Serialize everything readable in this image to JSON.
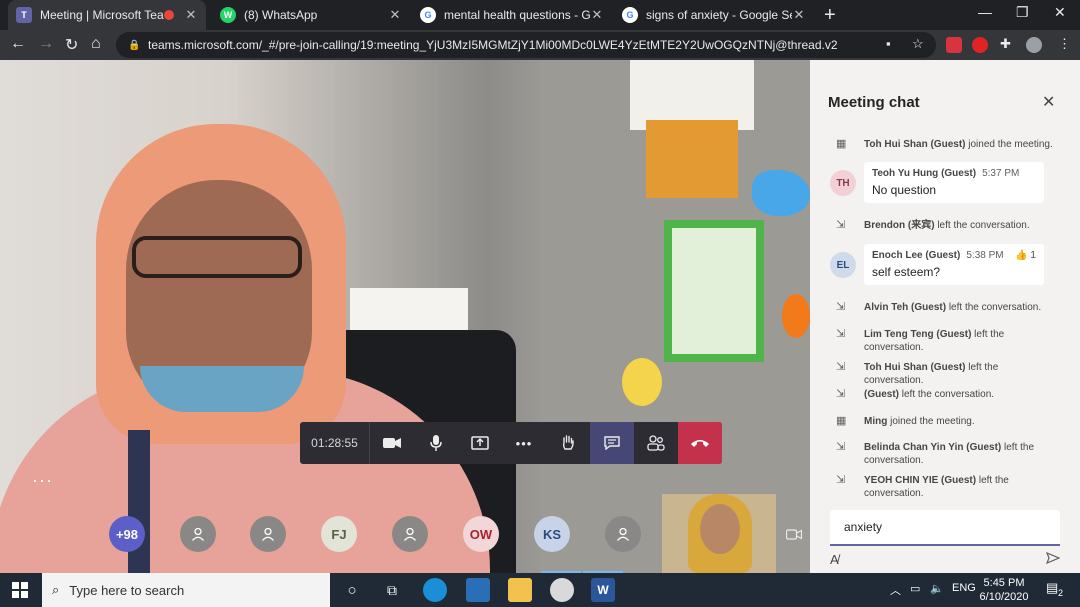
{
  "browser": {
    "tabs": [
      {
        "title": "Meeting | Microsoft Teams",
        "favicon": "T",
        "color": "#6264a7",
        "recording": true,
        "active": true
      },
      {
        "title": "(8) WhatsApp",
        "favicon": "W",
        "color": "#25d366",
        "recording": false,
        "active": false
      },
      {
        "title": "mental health questions - Googl",
        "favicon": "G",
        "color": "#4285f4",
        "recording": false,
        "active": false
      },
      {
        "title": "signs of anxiety - Google Search",
        "favicon": "G",
        "color": "#4285f4",
        "recording": false,
        "active": false
      }
    ],
    "url": "teams.microsoft.com/_#/pre-join-calling/19:meeting_YjU3MzI5MGMtZjY1Mi00MDc0LWE4YzEtMTE2Y2UwOGQzNTNj@thread.v2",
    "tab_close_glyph": "✕",
    "new_tab_glyph": "+"
  },
  "meeting": {
    "timer": "01:28:55",
    "more_glyph": "•••",
    "participants": [
      {
        "label": "+98",
        "type": "count",
        "bg": "#5b5fc7",
        "fg": "#ffffff"
      },
      {
        "label": "",
        "type": "ghost",
        "bg": "#8a8886",
        "fg": "#ffffff"
      },
      {
        "label": "",
        "type": "ghost",
        "bg": "#8a8886",
        "fg": "#ffffff"
      },
      {
        "label": "FJ",
        "type": "initials",
        "bg": "#e1e4d6",
        "fg": "#58614a"
      },
      {
        "label": "",
        "type": "ghost",
        "bg": "#8a8886",
        "fg": "#ffffff"
      },
      {
        "label": "OW",
        "type": "initials",
        "bg": "#f3d6d8",
        "fg": "#a4262c"
      },
      {
        "label": "KS",
        "type": "initials",
        "bg": "#c7d4e8",
        "fg": "#2f4b7c"
      },
      {
        "label": "",
        "type": "ghost",
        "bg": "#8a8886",
        "fg": "#ffffff"
      }
    ]
  },
  "chat": {
    "title": "Meeting chat",
    "close_glyph": "✕",
    "items": [
      {
        "kind": "event",
        "icon": "calendar-icon",
        "bold": "Toh Hui Shan (Guest)",
        "text": " joined the meeting."
      },
      {
        "kind": "message",
        "initials": "TH",
        "avatar_bg": "#f1d0d6",
        "avatar_fg": "#8b3a4a",
        "author": "Teoh Yu Hung (Guest)",
        "time": "5:37 PM",
        "body": "No question",
        "reaction": ""
      },
      {
        "kind": "event",
        "icon": "leave-icon",
        "bold": "Brendon (来宾)",
        "text": " left the conversation."
      },
      {
        "kind": "message",
        "initials": "EL",
        "avatar_bg": "#cfdbea",
        "avatar_fg": "#2f4b7c",
        "author": "Enoch Lee (Guest)",
        "time": "5:38 PM",
        "body": "self esteem?",
        "reaction": "👍 1"
      },
      {
        "kind": "event",
        "icon": "leave-icon",
        "bold": "Alvin Teh (Guest)",
        "text": " left the conversation."
      },
      {
        "kind": "event",
        "icon": "leave-icon",
        "bold": "Lim Teng Teng (Guest)",
        "text": " left the conversation."
      },
      {
        "kind": "event",
        "icon": "leave-icon",
        "bold": "Toh Hui Shan (Guest)",
        "text": " left the conversation."
      },
      {
        "kind": "event",
        "icon": "leave-icon",
        "bold": "(Guest)",
        "text": " left the conversation."
      },
      {
        "kind": "event",
        "icon": "calendar-icon",
        "bold": "Ming",
        "text": " joined the meeting."
      },
      {
        "kind": "event",
        "icon": "leave-icon",
        "bold": "Belinda Chan Yin Yin (Guest)",
        "text": " left the conversation."
      },
      {
        "kind": "event",
        "icon": "leave-icon",
        "bold": "YEOH CHIN YIE (Guest)",
        "text": " left the conversation."
      }
    ],
    "compose_value": "anxiety"
  },
  "taskbar": {
    "search_placeholder": "Type here to search",
    "language": "ENG",
    "time": "5:45 PM",
    "date": "6/10/2020",
    "notifications": "2"
  }
}
